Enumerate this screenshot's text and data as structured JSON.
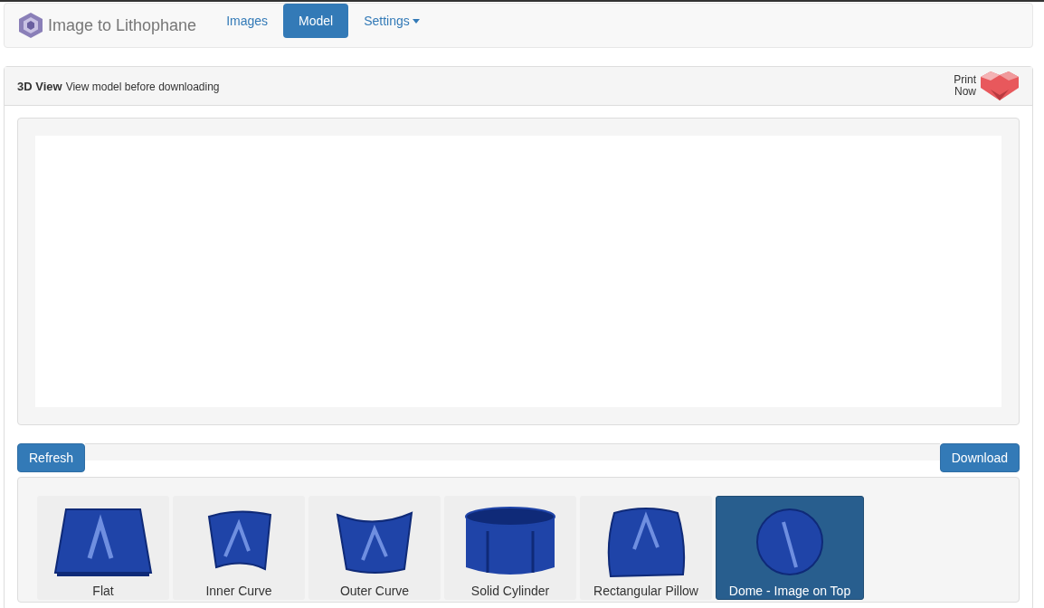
{
  "navbar": {
    "brand": "Image to Lithophane",
    "items": [
      {
        "label": "Images",
        "selected": false,
        "kind": "link"
      },
      {
        "label": "Model",
        "selected": true,
        "kind": "link"
      },
      {
        "label": "Settings",
        "selected": false,
        "kind": "dropdown"
      }
    ]
  },
  "panel": {
    "title": "3D View",
    "subtitle": "View model before downloading",
    "print_now": [
      "Print",
      "Now"
    ]
  },
  "progress": {
    "level": 0
  },
  "buttons": {
    "refresh": "Refresh",
    "download": "Download"
  },
  "shapes": [
    {
      "label": "Flat",
      "kind": "flat",
      "selected": false
    },
    {
      "label": "Inner Curve",
      "kind": "inner",
      "selected": false
    },
    {
      "label": "Outer Curve",
      "kind": "outer",
      "selected": false
    },
    {
      "label": "Solid Cylinder",
      "kind": "cylinder",
      "selected": false
    },
    {
      "label": "Rectangular Pillow",
      "kind": "pillow",
      "selected": false
    },
    {
      "label": "Dome - Image on Top",
      "kind": "dome",
      "selected": true
    }
  ]
}
